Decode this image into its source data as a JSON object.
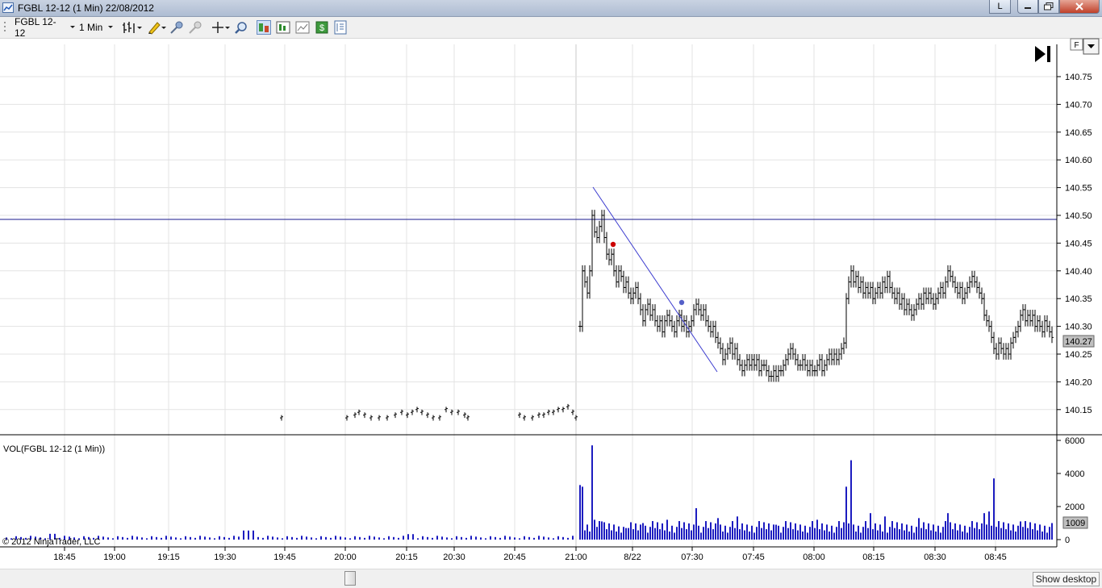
{
  "window": {
    "title": "FGBL 12-12 (1 Min)  22/08/2012",
    "buttons": {
      "restore_label": "L",
      "minimize": "minimize-icon",
      "maximize": "maximize-icon",
      "close": "close-icon"
    }
  },
  "toolbar": {
    "instrument": "FGBL 12-12",
    "interval": "1 Min",
    "icons": [
      "bar-type-icon",
      "pencil-draw-icon",
      "add-indicator-icon",
      "remove-indicator-icon",
      "crosshair-icon",
      "zoom-icon",
      "chart-trader-icon",
      "strategies-icon",
      "data-box-icon",
      "dollar-icon",
      "properties-icon"
    ]
  },
  "chart": {
    "f_button": "F",
    "price_labels": [
      "140.75",
      "140.70",
      "140.65",
      "140.60",
      "140.55",
      "140.50",
      "140.45",
      "140.40",
      "140.35",
      "140.30",
      "140.25",
      "140.20",
      "140.15"
    ],
    "last_price": "140.27",
    "volume_label": "VOL(FGBL 12-12 (1 Min))",
    "volume_axis_labels": [
      "6000",
      "4000",
      "2000",
      "0"
    ],
    "last_volume": "1009",
    "copyright": "© 2012 NinjaTrader, LLC",
    "time_labels": [
      "18:45",
      "19:00",
      "19:15",
      "19:30",
      "19:45",
      "20:00",
      "20:15",
      "20:30",
      "20:45",
      "21:00",
      "8/22",
      "07:30",
      "07:45",
      "08:00",
      "08:15",
      "08:30",
      "08:45"
    ],
    "colors": {
      "horizontal_line": "#1a1a8c",
      "trend_line": "#3b3bcf",
      "volume_bar": "#1c1cc0",
      "entry_dot": "#cc0000",
      "exit_dot": "#5560c8"
    }
  },
  "taskbar": {
    "show_desktop": "Show desktop"
  },
  "chart_data": {
    "type": "line",
    "title": "FGBL 12-12 (1 Min)",
    "xlabel": "",
    "ylabel": "",
    "x": [
      "18:45",
      "19:00",
      "19:15",
      "19:30",
      "19:45",
      "20:00",
      "20:15",
      "20:30",
      "20:45",
      "21:00",
      "8/22",
      "07:30",
      "07:45",
      "08:00",
      "08:15",
      "08:30",
      "08:45"
    ],
    "ylim": [
      140.13,
      140.78
    ],
    "horizontal_line": 140.49,
    "trend_line": {
      "from": [
        "21:00",
        140.55
      ],
      "to": [
        "07:40",
        140.21
      ]
    },
    "series": [
      {
        "values": [
          null,
          null,
          null,
          null,
          null,
          140.14,
          140.15,
          140.14,
          140.14,
          140.3,
          140.4,
          140.33,
          140.23,
          140.22,
          140.37,
          140.36,
          140.27
        ]
      }
    ],
    "volume": {
      "ylim": [
        0,
        6000
      ],
      "last": 1009
    }
  }
}
